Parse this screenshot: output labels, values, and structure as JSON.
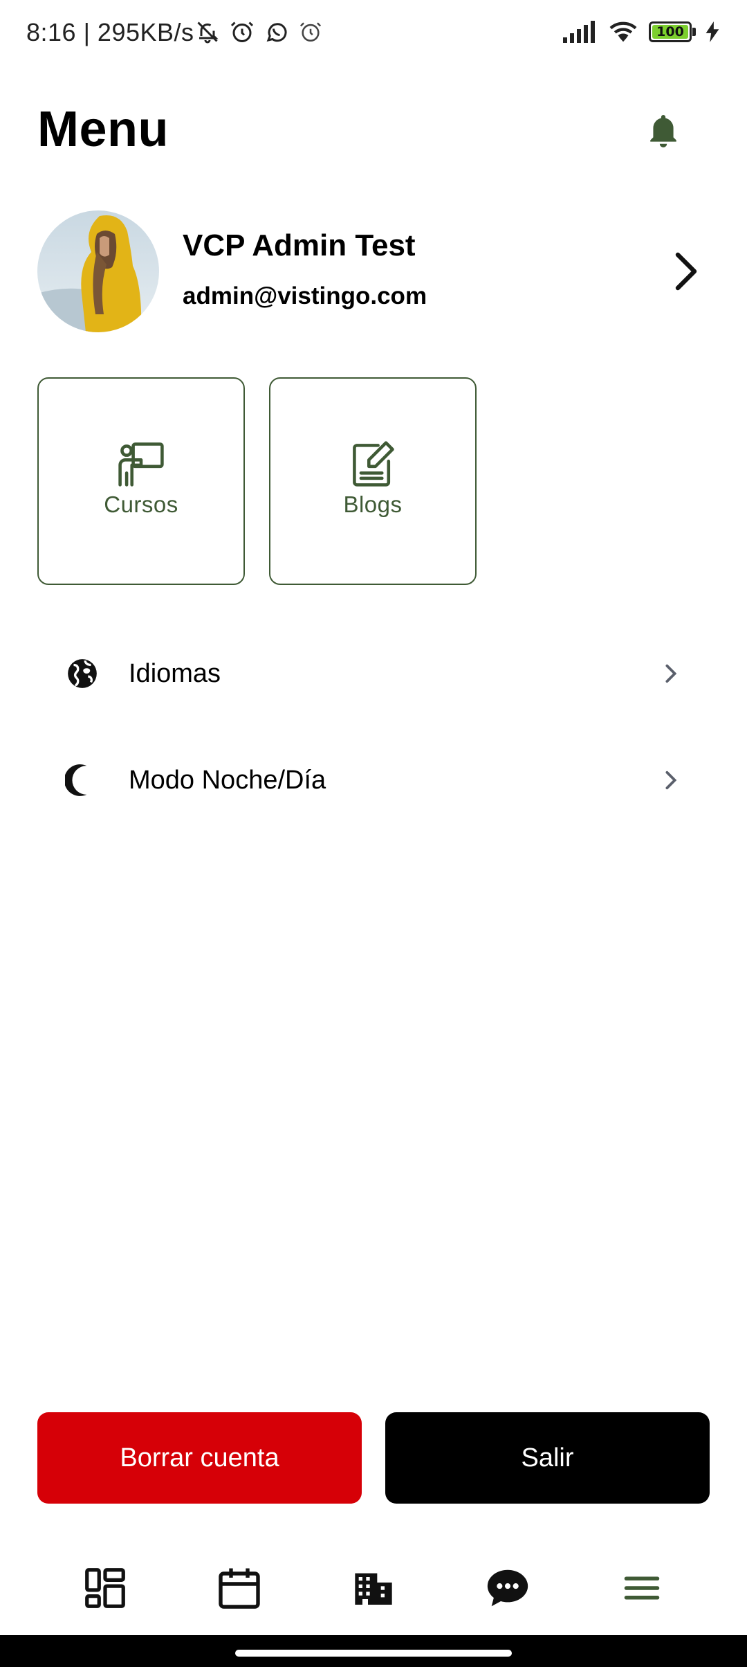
{
  "status_bar": {
    "time_speed": "8:16 | 295KB/s",
    "battery_level": "100",
    "battery_color": "#7ccf2e"
  },
  "header": {
    "title": "Menu",
    "bell_icon": "bell-icon"
  },
  "profile": {
    "name": "VCP Admin Test",
    "email": "admin@vistingo.com"
  },
  "tiles": [
    {
      "label": "Cursos",
      "icon": "teacher-board-icon"
    },
    {
      "label": "Blogs",
      "icon": "edit-note-icon"
    }
  ],
  "settings": [
    {
      "label": "Idiomas",
      "icon": "globe-icon"
    },
    {
      "label": "Modo Noche/Día",
      "icon": "moon-icon"
    }
  ],
  "buttons": {
    "delete_account": "Borrar cuenta",
    "logout": "Salir"
  },
  "bottom_nav": [
    {
      "name": "dashboard",
      "icon": "dashboard-icon"
    },
    {
      "name": "calendar",
      "icon": "calendar-icon"
    },
    {
      "name": "buildings",
      "icon": "building-icon"
    },
    {
      "name": "chat",
      "icon": "chat-icon"
    },
    {
      "name": "menu",
      "icon": "menu-icon",
      "active": true
    }
  ],
  "colors": {
    "accent_green": "#3f5a35",
    "danger_red": "#d60007",
    "black": "#000000"
  }
}
